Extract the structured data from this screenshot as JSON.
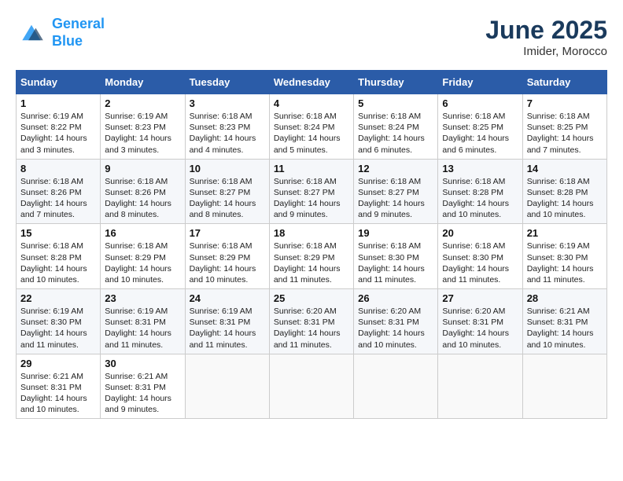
{
  "logo": {
    "line1": "General",
    "line2": "Blue"
  },
  "title": "June 2025",
  "location": "Imider, Morocco",
  "days_header": [
    "Sunday",
    "Monday",
    "Tuesday",
    "Wednesday",
    "Thursday",
    "Friday",
    "Saturday"
  ],
  "weeks": [
    [
      {
        "day": "1",
        "sunrise": "6:19 AM",
        "sunset": "8:22 PM",
        "daylight": "14 hours and 3 minutes."
      },
      {
        "day": "2",
        "sunrise": "6:19 AM",
        "sunset": "8:23 PM",
        "daylight": "14 hours and 3 minutes."
      },
      {
        "day": "3",
        "sunrise": "6:18 AM",
        "sunset": "8:23 PM",
        "daylight": "14 hours and 4 minutes."
      },
      {
        "day": "4",
        "sunrise": "6:18 AM",
        "sunset": "8:24 PM",
        "daylight": "14 hours and 5 minutes."
      },
      {
        "day": "5",
        "sunrise": "6:18 AM",
        "sunset": "8:24 PM",
        "daylight": "14 hours and 6 minutes."
      },
      {
        "day": "6",
        "sunrise": "6:18 AM",
        "sunset": "8:25 PM",
        "daylight": "14 hours and 6 minutes."
      },
      {
        "day": "7",
        "sunrise": "6:18 AM",
        "sunset": "8:25 PM",
        "daylight": "14 hours and 7 minutes."
      }
    ],
    [
      {
        "day": "8",
        "sunrise": "6:18 AM",
        "sunset": "8:26 PM",
        "daylight": "14 hours and 7 minutes."
      },
      {
        "day": "9",
        "sunrise": "6:18 AM",
        "sunset": "8:26 PM",
        "daylight": "14 hours and 8 minutes."
      },
      {
        "day": "10",
        "sunrise": "6:18 AM",
        "sunset": "8:27 PM",
        "daylight": "14 hours and 8 minutes."
      },
      {
        "day": "11",
        "sunrise": "6:18 AM",
        "sunset": "8:27 PM",
        "daylight": "14 hours and 9 minutes."
      },
      {
        "day": "12",
        "sunrise": "6:18 AM",
        "sunset": "8:27 PM",
        "daylight": "14 hours and 9 minutes."
      },
      {
        "day": "13",
        "sunrise": "6:18 AM",
        "sunset": "8:28 PM",
        "daylight": "14 hours and 10 minutes."
      },
      {
        "day": "14",
        "sunrise": "6:18 AM",
        "sunset": "8:28 PM",
        "daylight": "14 hours and 10 minutes."
      }
    ],
    [
      {
        "day": "15",
        "sunrise": "6:18 AM",
        "sunset": "8:28 PM",
        "daylight": "14 hours and 10 minutes."
      },
      {
        "day": "16",
        "sunrise": "6:18 AM",
        "sunset": "8:29 PM",
        "daylight": "14 hours and 10 minutes."
      },
      {
        "day": "17",
        "sunrise": "6:18 AM",
        "sunset": "8:29 PM",
        "daylight": "14 hours and 10 minutes."
      },
      {
        "day": "18",
        "sunrise": "6:18 AM",
        "sunset": "8:29 PM",
        "daylight": "14 hours and 11 minutes."
      },
      {
        "day": "19",
        "sunrise": "6:18 AM",
        "sunset": "8:30 PM",
        "daylight": "14 hours and 11 minutes."
      },
      {
        "day": "20",
        "sunrise": "6:18 AM",
        "sunset": "8:30 PM",
        "daylight": "14 hours and 11 minutes."
      },
      {
        "day": "21",
        "sunrise": "6:19 AM",
        "sunset": "8:30 PM",
        "daylight": "14 hours and 11 minutes."
      }
    ],
    [
      {
        "day": "22",
        "sunrise": "6:19 AM",
        "sunset": "8:30 PM",
        "daylight": "14 hours and 11 minutes."
      },
      {
        "day": "23",
        "sunrise": "6:19 AM",
        "sunset": "8:31 PM",
        "daylight": "14 hours and 11 minutes."
      },
      {
        "day": "24",
        "sunrise": "6:19 AM",
        "sunset": "8:31 PM",
        "daylight": "14 hours and 11 minutes."
      },
      {
        "day": "25",
        "sunrise": "6:20 AM",
        "sunset": "8:31 PM",
        "daylight": "14 hours and 11 minutes."
      },
      {
        "day": "26",
        "sunrise": "6:20 AM",
        "sunset": "8:31 PM",
        "daylight": "14 hours and 10 minutes."
      },
      {
        "day": "27",
        "sunrise": "6:20 AM",
        "sunset": "8:31 PM",
        "daylight": "14 hours and 10 minutes."
      },
      {
        "day": "28",
        "sunrise": "6:21 AM",
        "sunset": "8:31 PM",
        "daylight": "14 hours and 10 minutes."
      }
    ],
    [
      {
        "day": "29",
        "sunrise": "6:21 AM",
        "sunset": "8:31 PM",
        "daylight": "14 hours and 10 minutes."
      },
      {
        "day": "30",
        "sunrise": "6:21 AM",
        "sunset": "8:31 PM",
        "daylight": "14 hours and 9 minutes."
      },
      null,
      null,
      null,
      null,
      null
    ]
  ],
  "labels": {
    "sunrise": "Sunrise:",
    "sunset": "Sunset:",
    "daylight": "Daylight:"
  }
}
